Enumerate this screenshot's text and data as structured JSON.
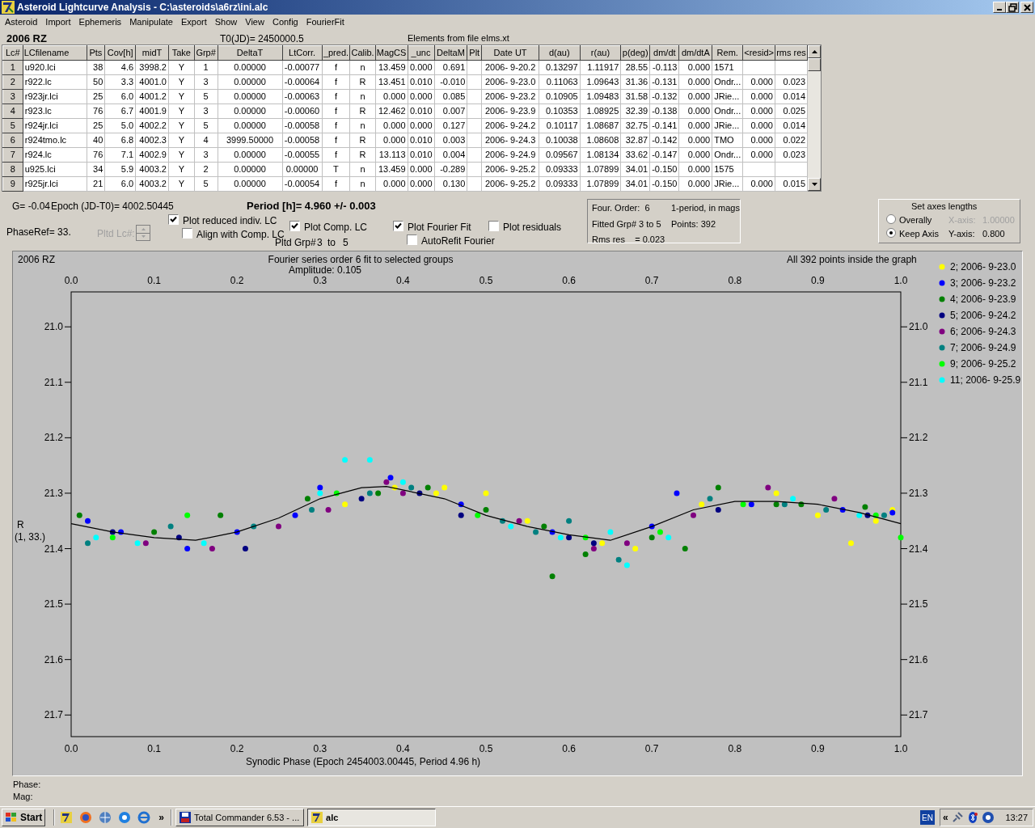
{
  "window": {
    "title": "Asteroid Lightcurve Analysis - C:\\asteroids\\a6rz\\ini.alc"
  },
  "menu": [
    "Asteroid",
    "Import",
    "Ephemeris",
    "Manipulate",
    "Export",
    "Show",
    "View",
    "Config",
    "FourierFit"
  ],
  "header": {
    "object": "2006 RZ",
    "t0": "T0(JD)= 2450000.5",
    "elements": "Elements from file elms.xt"
  },
  "table": {
    "columns": [
      "Lc#",
      "LCfilename",
      "Pts",
      "Cov[h]",
      "midT",
      "Take",
      "Grp#",
      "DeltaT",
      "LtCorr.",
      "_pred.",
      "Calib.",
      "MagCS",
      "_unc",
      "DeltaM",
      "Plt",
      "Date UT",
      "d(au)",
      "r(au)",
      "p(deg)",
      "dm/dt",
      "dm/dtA",
      "Rem.",
      "<resid>",
      "rms res"
    ],
    "rows": [
      [
        "1",
        "u920.lci",
        "38",
        "4.6",
        "3998.2",
        "Y",
        "1",
        "0.00000",
        "-0.00077",
        "f",
        "n",
        "13.459",
        "0.000",
        "0.691",
        "",
        "2006- 9-20.2",
        "0.13297",
        "1.11917",
        "28.55",
        "-0.113",
        "0.000",
        "1571",
        "",
        ""
      ],
      [
        "2",
        "r922.lc",
        "50",
        "3.3",
        "4001.0",
        "Y",
        "3",
        "0.00000",
        "-0.00064",
        "f",
        "R",
        "13.451",
        "0.010",
        "-0.010",
        "",
        "2006- 9-23.0",
        "0.11063",
        "1.09643",
        "31.36",
        "-0.131",
        "0.000",
        "Ondr...",
        "0.000",
        "0.023"
      ],
      [
        "3",
        "r923jr.lci",
        "25",
        "6.0",
        "4001.2",
        "Y",
        "5",
        "0.00000",
        "-0.00063",
        "f",
        "n",
        "0.000",
        "0.000",
        "0.085",
        "",
        "2006- 9-23.2",
        "0.10905",
        "1.09483",
        "31.58",
        "-0.132",
        "0.000",
        "JRie...",
        "0.000",
        "0.014"
      ],
      [
        "4",
        "r923.lc",
        "76",
        "6.7",
        "4001.9",
        "Y",
        "3",
        "0.00000",
        "-0.00060",
        "f",
        "R",
        "12.462",
        "0.010",
        "0.007",
        "",
        "2006- 9-23.9",
        "0.10353",
        "1.08925",
        "32.39",
        "-0.138",
        "0.000",
        "Ondr...",
        "0.000",
        "0.025"
      ],
      [
        "5",
        "r924jr.lci",
        "25",
        "5.0",
        "4002.2",
        "Y",
        "5",
        "0.00000",
        "-0.00058",
        "f",
        "n",
        "0.000",
        "0.000",
        "0.127",
        "",
        "2006- 9-24.2",
        "0.10117",
        "1.08687",
        "32.75",
        "-0.141",
        "0.000",
        "JRie...",
        "0.000",
        "0.014"
      ],
      [
        "6",
        "r924tmo.lc",
        "40",
        "6.8",
        "4002.3",
        "Y",
        "4",
        "3999.50000",
        "-0.00058",
        "f",
        "R",
        "0.000",
        "0.010",
        "0.003",
        "",
        "2006- 9-24.3",
        "0.10038",
        "1.08608",
        "32.87",
        "-0.142",
        "0.000",
        "TMO",
        "0.000",
        "0.022"
      ],
      [
        "7",
        "r924.lc",
        "76",
        "7.1",
        "4002.9",
        "Y",
        "3",
        "0.00000",
        "-0.00055",
        "f",
        "R",
        "13.113",
        "0.010",
        "0.004",
        "",
        "2006- 9-24.9",
        "0.09567",
        "1.08134",
        "33.62",
        "-0.147",
        "0.000",
        "Ondr...",
        "0.000",
        "0.023"
      ],
      [
        "8",
        "u925.lci",
        "34",
        "5.9",
        "4003.2",
        "Y",
        "2",
        "0.00000",
        "0.00000",
        "T",
        "n",
        "13.459",
        "0.000",
        "-0.289",
        "",
        "2006- 9-25.2",
        "0.09333",
        "1.07899",
        "34.01",
        "-0.150",
        "0.000",
        "1575",
        "",
        ""
      ],
      [
        "9",
        "r925jr.lci",
        "21",
        "6.0",
        "4003.2",
        "Y",
        "5",
        "0.00000",
        "-0.00054",
        "f",
        "n",
        "0.000",
        "0.000",
        "0.130",
        "",
        "2006- 9-25.2",
        "0.09333",
        "1.07899",
        "34.01",
        "-0.150",
        "0.000",
        "JRie...",
        "0.000",
        "0.015"
      ]
    ]
  },
  "summary": {
    "g": "G= -0.04",
    "epoch": "Epoch (JD-T0)= 4002.50445",
    "period": "Period [h]= 4.960 +/- 0.003",
    "phase_ref": "PhaseRef= 33.",
    "pltd_lc": {
      "label": "Pltd Lc#:",
      "disabled": true
    }
  },
  "options": [
    {
      "label": "Plot reduced indiv. LC",
      "checked": true
    },
    {
      "label": "Plot Comp. LC",
      "checked": true
    },
    {
      "label": "Plot Fourier Fit",
      "checked": true
    },
    {
      "label": "Plot residuals",
      "checked": false
    },
    {
      "label": "Align with Comp. LC",
      "checked": false
    },
    {
      "label": "AutoRefit Fourier",
      "checked": false
    }
  ],
  "pltd_grp": {
    "label": "Pltd Grp#",
    "from": "3",
    "sep": "to",
    "to": "5"
  },
  "fit_info": [
    [
      "Four. Order:  6",
      "1-period, in mags"
    ],
    [
      "Fitted Grp# 3 to 5",
      "Points: 392"
    ],
    [
      "Rms res    = 0.023"
    ]
  ],
  "axes": {
    "title": "Set axes lengths",
    "modes": [
      {
        "label": "Overally",
        "selected": false
      },
      {
        "label": "Keep Axis",
        "selected": true
      }
    ],
    "fields": [
      {
        "label": "X-axis:",
        "value": "1.00000",
        "disabled": true
      },
      {
        "label": "Y-axis:",
        "value": "0.800",
        "disabled": false
      }
    ]
  },
  "plot": {
    "object": "2006 RZ",
    "title": "Fourier series order 6 fit to selected groups",
    "amplitude": "Amplitude: 0.105",
    "note": "All 392 points inside the graph",
    "ylabel_sub": "(1, 33.)",
    "chart_data": {
      "type": "scatter",
      "legend": "right",
      "xlabel": "Synodic Phase (Epoch 2454003.00445, Period 4.96 h)",
      "ylabel": "R",
      "xlim": [
        0,
        1
      ],
      "ylim": [
        21.739,
        20.937
      ],
      "xticks": [
        {
          "value": 0,
          "label": "0.0"
        },
        {
          "value": 0.1,
          "label": "0.1"
        },
        {
          "value": 0.2,
          "label": "0.2"
        },
        {
          "value": 0.3,
          "label": "0.3"
        },
        {
          "value": 0.4,
          "label": "0.4"
        },
        {
          "value": 0.5,
          "label": "0.5"
        },
        {
          "value": 0.6,
          "label": "0.6"
        },
        {
          "value": 0.7,
          "label": "0.7"
        },
        {
          "value": 0.8,
          "label": "0.8"
        },
        {
          "value": 0.9,
          "label": "0.9"
        },
        {
          "value": 1,
          "label": "1.0"
        }
      ],
      "yticks": [
        {
          "value": 21.0,
          "label": "21.0"
        },
        {
          "value": 21.1,
          "label": "21.1"
        },
        {
          "value": 21.2,
          "label": "21.2"
        },
        {
          "value": 21.3,
          "label": "21.3"
        },
        {
          "value": 21.4,
          "label": "21.4"
        },
        {
          "value": 21.5,
          "label": "21.5"
        },
        {
          "value": 21.6,
          "label": "21.6"
        },
        {
          "value": 21.7,
          "label": "21.7"
        }
      ],
      "series": [
        {
          "name": "2; 2006- 9-23.0",
          "color": "#ffff00",
          "x": [
            0.33,
            0.39,
            0.44,
            0.45,
            0.5,
            0.55,
            0.64,
            0.68,
            0.76,
            0.85,
            0.9,
            0.94,
            0.97,
            0.99
          ],
          "values": [
            21.32,
            21.29,
            21.3,
            21.29,
            21.3,
            21.35,
            21.39,
            21.4,
            21.32,
            21.3,
            21.34,
            21.39,
            21.35,
            21.33
          ]
        },
        {
          "name": "3; 2006- 9-23.2",
          "color": "#0000ff",
          "x": [
            0.02,
            0.06,
            0.14,
            0.2,
            0.27,
            0.3,
            0.385,
            0.47,
            0.58,
            0.7,
            0.73,
            0.82,
            0.93,
            0.99
          ],
          "values": [
            21.35,
            21.37,
            21.4,
            21.37,
            21.34,
            21.29,
            21.272,
            21.32,
            21.37,
            21.36,
            21.3,
            21.32,
            21.33,
            21.335
          ]
        },
        {
          "name": "4; 2006- 9-23.9",
          "color": "#008000",
          "x": [
            0.01,
            0.1,
            0.18,
            0.285,
            0.37,
            0.43,
            0.5,
            0.57,
            0.58,
            0.62,
            0.7,
            0.74,
            0.78,
            0.85,
            0.88,
            0.957
          ],
          "values": [
            21.34,
            21.37,
            21.34,
            21.31,
            21.3,
            21.29,
            21.33,
            21.36,
            21.45,
            21.41,
            21.38,
            21.4,
            21.29,
            21.32,
            21.32,
            21.325
          ]
        },
        {
          "name": "5; 2006- 9-24.2",
          "color": "#000080",
          "x": [
            0.05,
            0.13,
            0.21,
            0.35,
            0.42,
            0.47,
            0.6,
            0.63,
            0.78,
            0.96
          ],
          "values": [
            21.37,
            21.38,
            21.4,
            21.31,
            21.3,
            21.34,
            21.38,
            21.39,
            21.33,
            21.34
          ]
        },
        {
          "name": "6; 2006- 9-24.3",
          "color": "#800080",
          "x": [
            0.09,
            0.17,
            0.25,
            0.31,
            0.38,
            0.4,
            0.54,
            0.63,
            0.67,
            0.75,
            0.84,
            0.92
          ],
          "values": [
            21.39,
            21.4,
            21.36,
            21.33,
            21.28,
            21.3,
            21.35,
            21.4,
            21.39,
            21.34,
            21.29,
            21.31
          ]
        },
        {
          "name": "7; 2006- 9-24.9",
          "color": "#008080",
          "x": [
            0.02,
            0.12,
            0.22,
            0.29,
            0.36,
            0.41,
            0.52,
            0.56,
            0.6,
            0.66,
            0.77,
            0.86,
            0.91,
            0.98
          ],
          "values": [
            21.39,
            21.36,
            21.36,
            21.33,
            21.3,
            21.29,
            21.35,
            21.37,
            21.35,
            21.42,
            21.31,
            21.32,
            21.33,
            21.34
          ]
        },
        {
          "name": "9; 2006- 9-25.2",
          "color": "#00ff00",
          "x": [
            0.05,
            0.14,
            0.32,
            0.49,
            0.62,
            0.71,
            0.81,
            0.97,
            1.0
          ],
          "values": [
            21.38,
            21.34,
            21.3,
            21.34,
            21.38,
            21.37,
            21.32,
            21.34,
            21.38
          ]
        },
        {
          "name": "11; 2006- 9-25.9",
          "color": "#00ffff",
          "x": [
            0.03,
            0.08,
            0.16,
            0.3,
            0.33,
            0.36,
            0.4,
            0.53,
            0.59,
            0.65,
            0.67,
            0.72,
            0.87,
            0.95
          ],
          "values": [
            21.38,
            21.39,
            21.39,
            21.3,
            21.24,
            21.24,
            21.28,
            21.36,
            21.38,
            21.37,
            21.43,
            21.38,
            21.31,
            21.34
          ]
        },
        {
          "type": "line",
          "color": "#000000",
          "x": [
            0,
            0.05,
            0.1,
            0.15,
            0.2,
            0.25,
            0.3,
            0.35,
            0.38,
            0.45,
            0.5,
            0.55,
            0.6,
            0.65,
            0.7,
            0.75,
            0.8,
            0.85,
            0.9,
            0.95,
            1
          ],
          "values": [
            21.355,
            21.37,
            21.38,
            21.385,
            21.37,
            21.345,
            21.31,
            21.29,
            21.288,
            21.31,
            21.34,
            21.36,
            21.375,
            21.385,
            21.36,
            21.33,
            21.315,
            21.315,
            21.32,
            21.335,
            21.355
          ]
        }
      ]
    }
  },
  "readout": [
    "Phase:",
    "Mag:"
  ],
  "taskbar": {
    "start": "Start",
    "more": "»",
    "tasks": [
      {
        "label": "Total Commander 6.53 - ...",
        "selected": false
      },
      {
        "label": "alc",
        "selected": true
      }
    ],
    "language": "EN",
    "tray_toggle": "«",
    "clock": "13:27"
  }
}
